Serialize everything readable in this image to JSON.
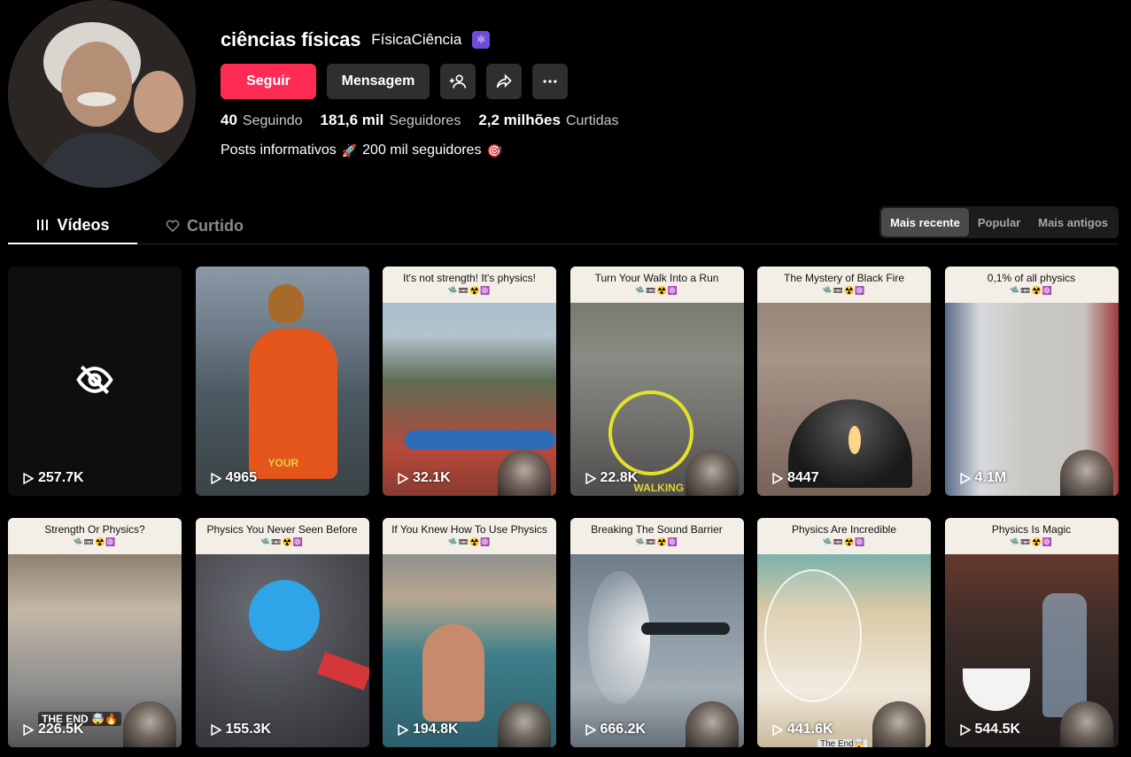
{
  "profile": {
    "username": "ciências físicas",
    "nickname": "FísicaCiência",
    "nickname_emoji": "⚛",
    "follow_label": "Seguir",
    "message_label": "Mensagem",
    "stats": [
      {
        "value": "40",
        "label": "Seguindo"
      },
      {
        "value": "181,6 mil",
        "label": "Seguidores"
      },
      {
        "value": "2,2 milhões",
        "label": "Curtidas"
      }
    ],
    "bio_text_1": "Posts informativos",
    "bio_emoji_1": "🚀",
    "bio_text_2": "200 mil seguidores",
    "bio_emoji_2": "🎯"
  },
  "tabs": {
    "videos": "Vídeos",
    "liked": "Curtido"
  },
  "sort": {
    "options": [
      "Mais recente",
      "Popular",
      "Mais antigos"
    ],
    "active": "Mais recente"
  },
  "videos": [
    {
      "caption": "",
      "views": "257.7K",
      "hidden": true
    },
    {
      "caption": "",
      "views": "4965",
      "overlay": "YOUR"
    },
    {
      "caption": "It's not strength! It's physics!",
      "views": "32.1K"
    },
    {
      "caption": "Turn Your Walk Into a Run",
      "views": "22.8K",
      "overlay": "WALKING"
    },
    {
      "caption": "The Mystery of Black Fire",
      "views": "8447"
    },
    {
      "caption": "0,1% of all physics",
      "views": "4.1M"
    },
    {
      "caption": "Strength Or Physics?",
      "views": "226.5K",
      "overlay": "THE END 🤯🔥"
    },
    {
      "caption": "Physics You Never Seen Before",
      "views": "155.3K"
    },
    {
      "caption": "If You Knew How To Use Physics",
      "views": "194.8K"
    },
    {
      "caption": "Breaking The Sound Barrier",
      "views": "666.2K"
    },
    {
      "caption": "Physics Are Incredible",
      "views": "441.6K",
      "overlay": "The End🤯"
    },
    {
      "caption": "Physics Is Magic",
      "views": "544.5K"
    }
  ],
  "caption_icons": "🛸📼☢️⚛️",
  "colors": {
    "accent": "#fe2c55",
    "background": "#000000",
    "button_secondary": "#2f2f2f"
  }
}
